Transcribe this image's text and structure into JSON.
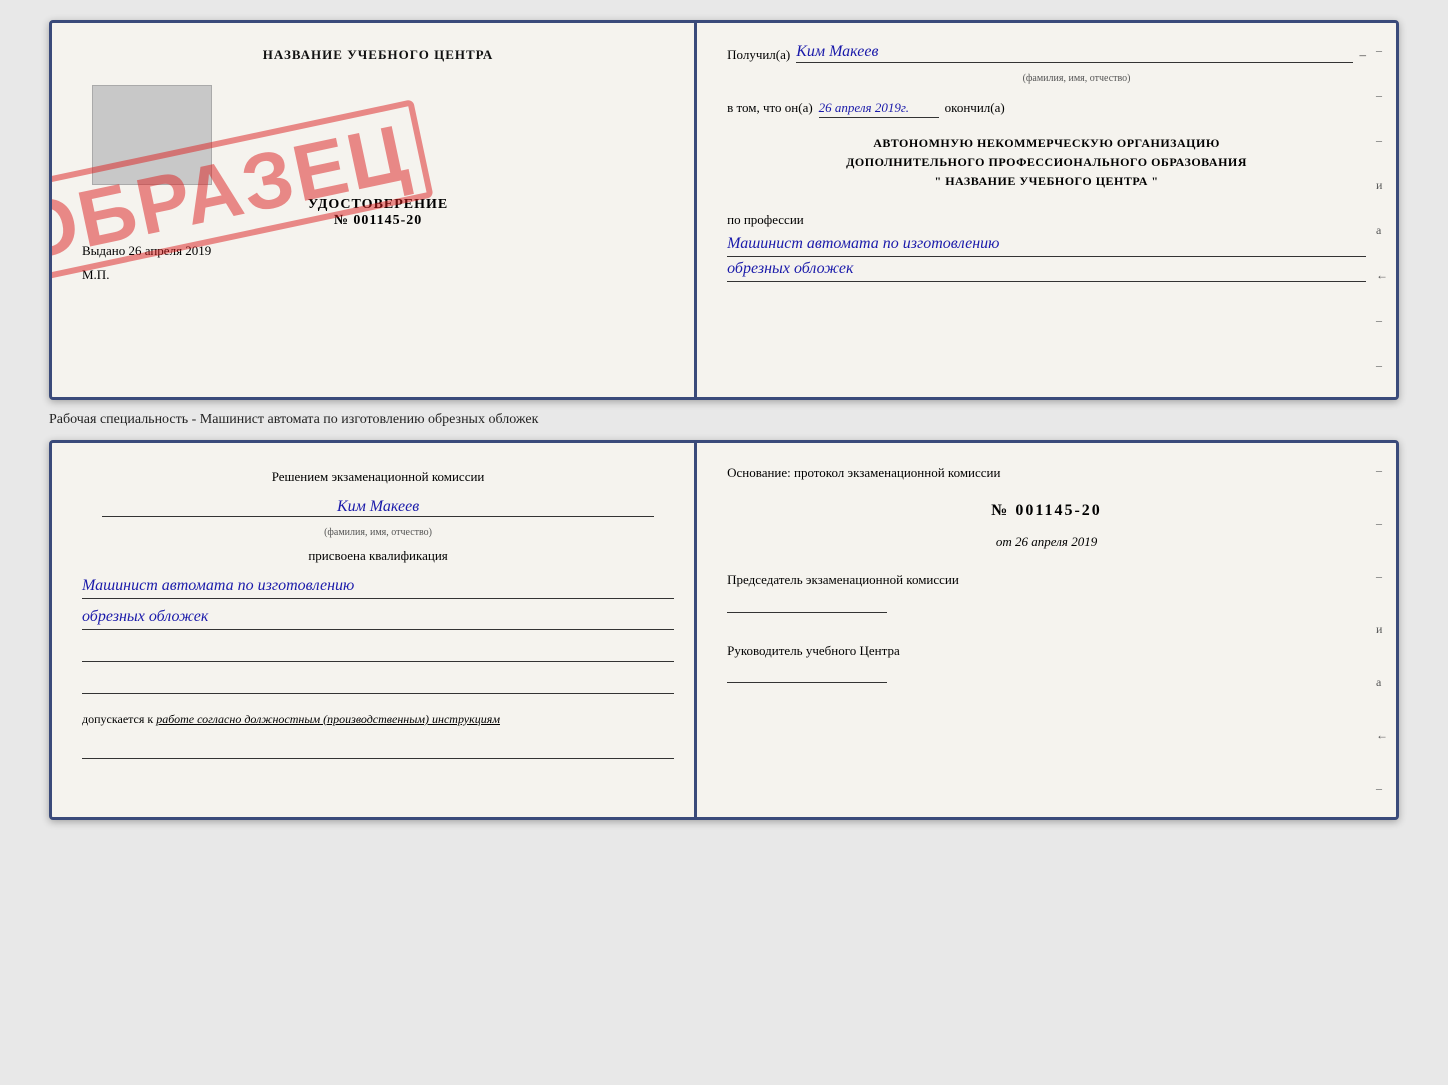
{
  "top_book": {
    "left_page": {
      "header": "НАЗВАНИЕ УЧЕБНОГО ЦЕНТРА",
      "udostoverenie_label": "УДОСТОВЕРЕНИЕ",
      "nomer": "№ 001145-20",
      "vydano_label": "Выдано",
      "vydano_date": "26 апреля 2019",
      "mp": "М.П.",
      "stamp": "ОБРАЗЕЦ"
    },
    "right_page": {
      "poluchil_label": "Получил(а)",
      "poluchil_name": "Ким Макеев",
      "poluchil_subtitle": "(фамилия, имя, отчество)",
      "vtom_label": "в том, что он(а)",
      "vtom_date": "26 апреля 2019г.",
      "okochnil_label": "окончил(а)",
      "org_line1": "АВТОНОМНУЮ НЕКОММЕРЧЕСКУЮ ОРГАНИЗАЦИЮ",
      "org_line2": "ДОПОЛНИТЕЛЬНОГО ПРОФЕССИОНАЛЬНОГО ОБРАЗОВАНИЯ",
      "org_line3": "\"   НАЗВАНИЕ УЧЕБНОГО ЦЕНТРА   \"",
      "profession_label": "по профессии",
      "profession_line1": "Машинист автомата по изготовлению",
      "profession_line2": "обрезных обложек"
    },
    "right_dashes": [
      "-",
      "-",
      "-",
      "и",
      "а",
      "←",
      "-",
      "-",
      "-",
      "-"
    ]
  },
  "separator": {
    "text": "Рабочая специальность - Машинист автомата по изготовлению обрезных обложек"
  },
  "bottom_book": {
    "left_page": {
      "komissia_header": "Решением экзаменационной комиссии",
      "komissia_name": "Ким Макеев",
      "komissia_subtitle": "(фамилия, имя, отчество)",
      "prisvoena_label": "присвоена квалификация",
      "kval_line1": "Машинист автомата по изготовлению",
      "kval_line2": "обрезных обложек",
      "dopuskaetsya_label": "допускается к",
      "dopuskaetsya_text": "работе согласно должностным (производственным) инструкциям"
    },
    "right_page": {
      "osnovanie_text": "Основание: протокол экзаменационной комиссии",
      "protocol_number": "№  001145-20",
      "protocol_date_prefix": "от",
      "protocol_date": "26 апреля 2019",
      "predsedatel_label": "Председатель экзаменационной комиссии",
      "rukovoditel_label": "Руководитель учебного Центра"
    },
    "right_dashes": [
      "-",
      "-",
      "-",
      "и",
      "а",
      "←",
      "-",
      "-",
      "-",
      "-"
    ]
  }
}
